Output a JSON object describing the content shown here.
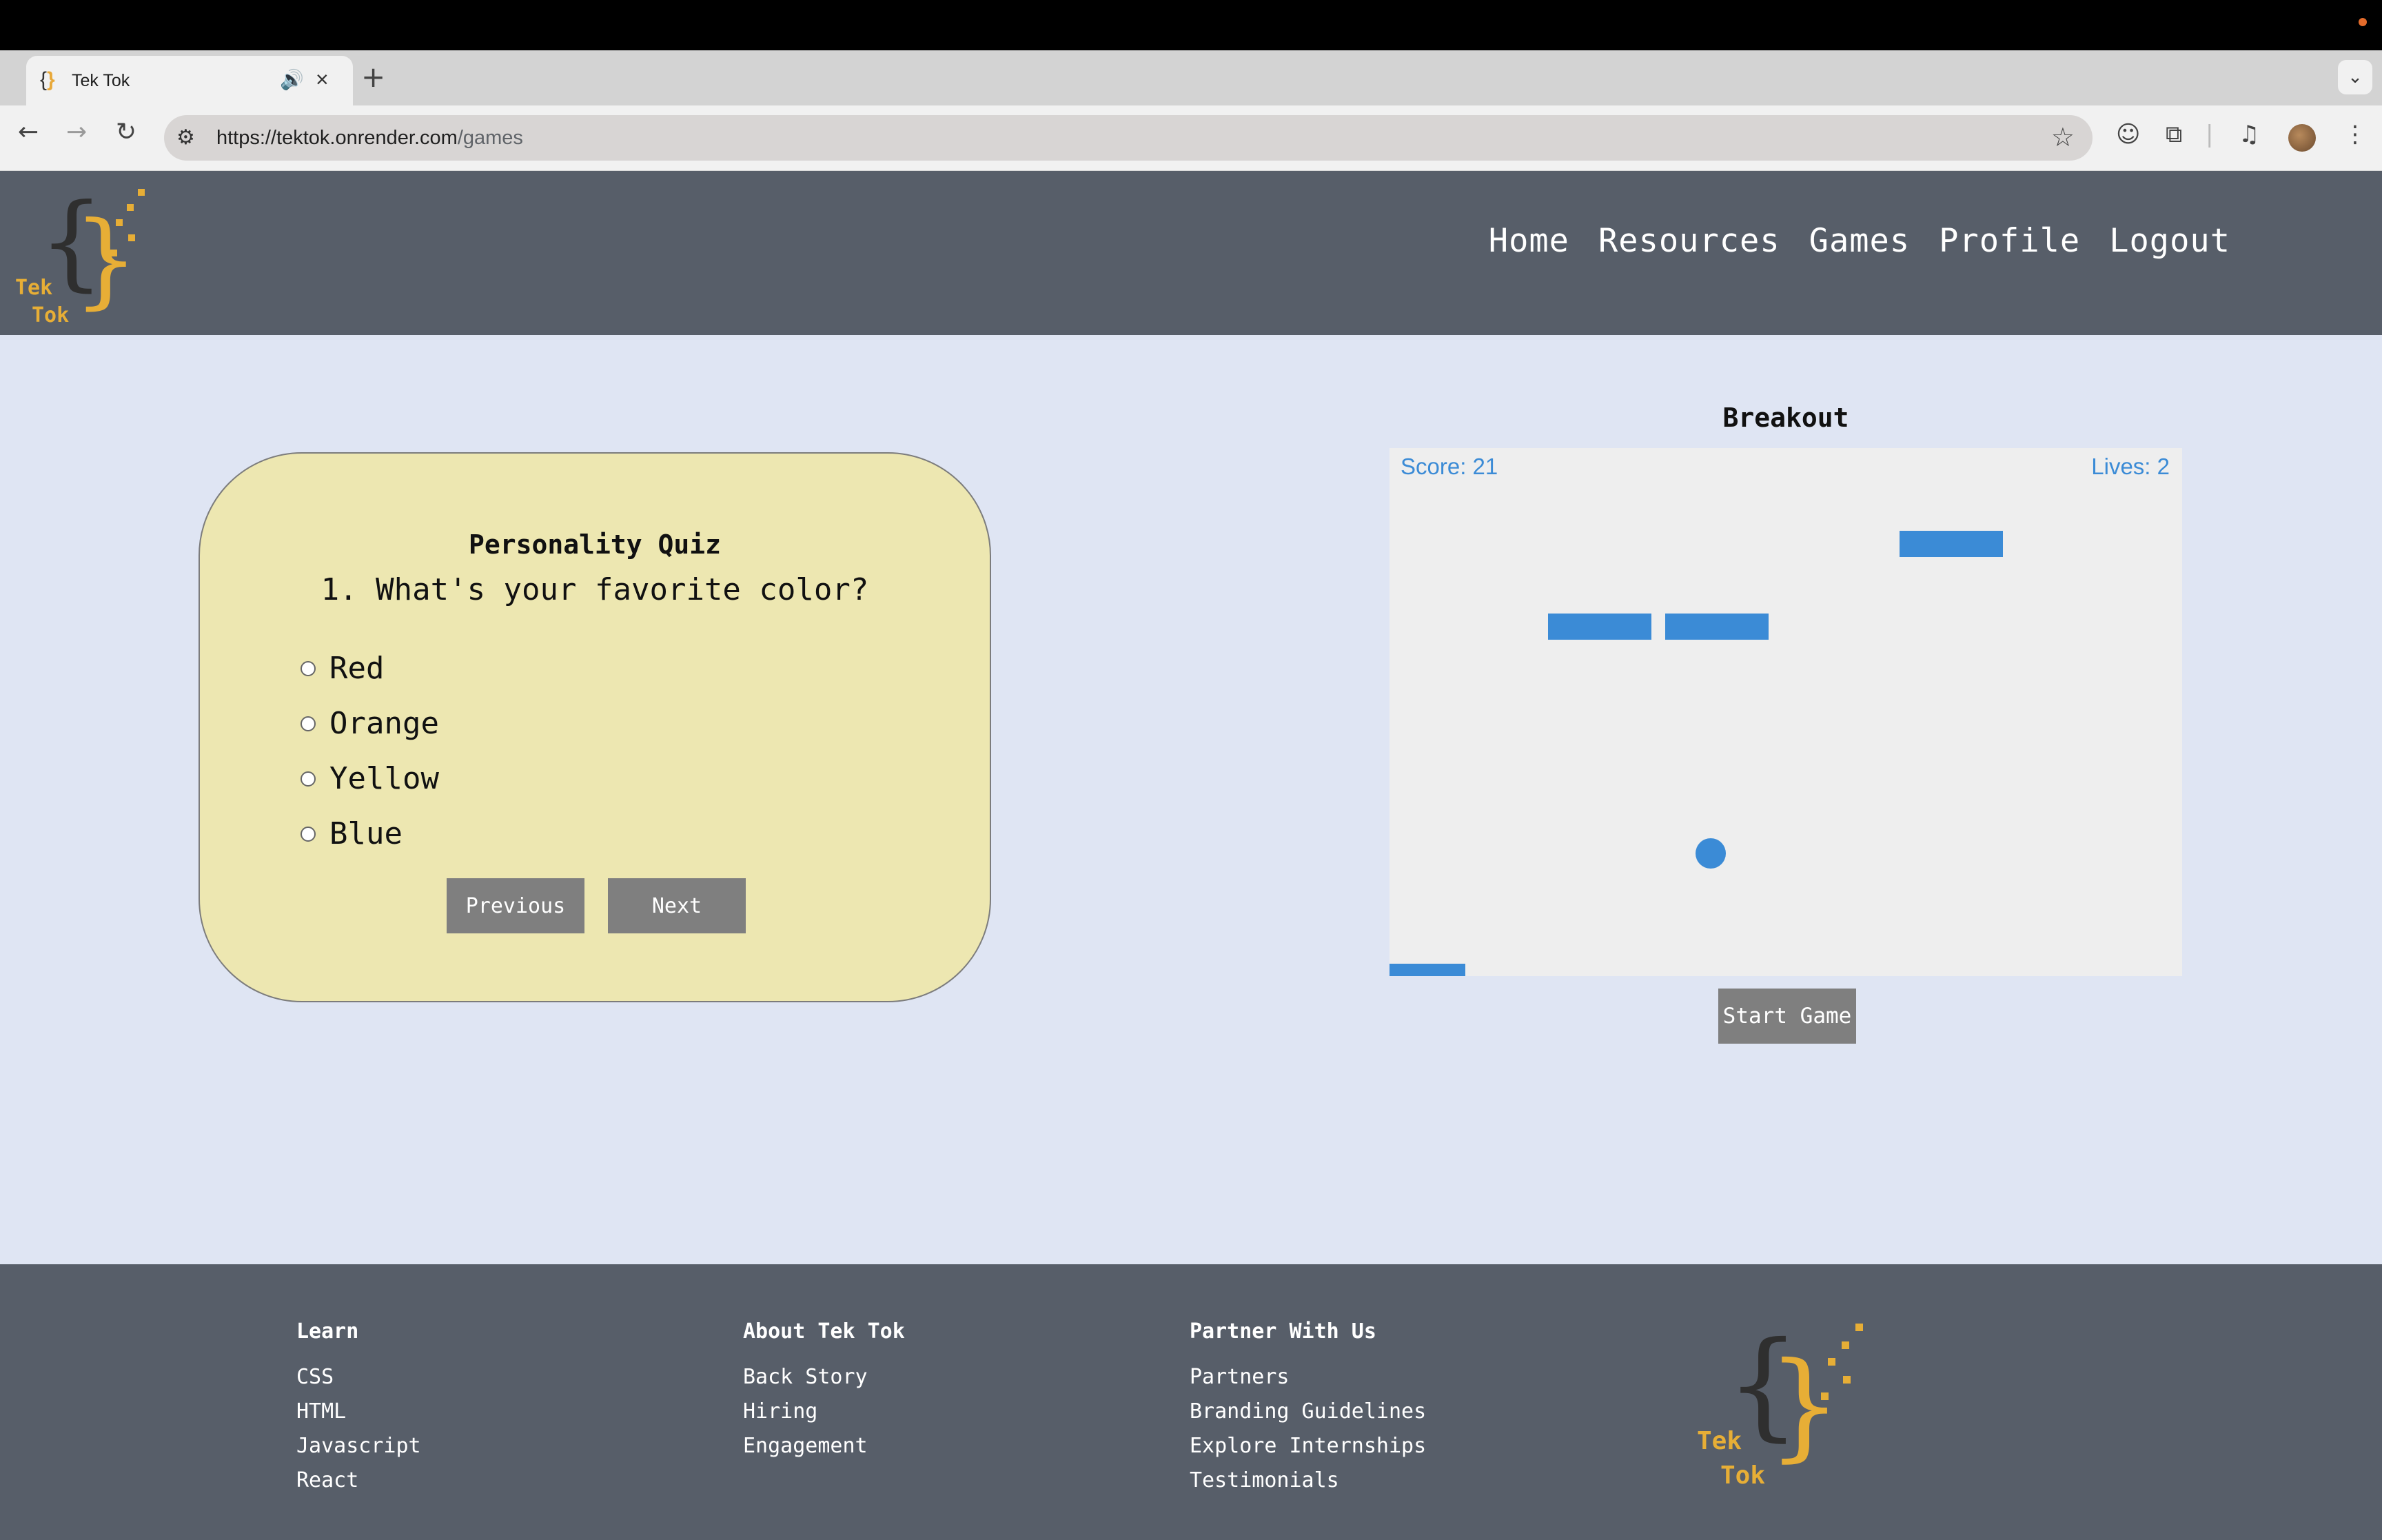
{
  "browser": {
    "tab_title": "Tek Tok",
    "new_tab": "+",
    "url_host": "https://tektok.onrender.com",
    "url_path": "/games"
  },
  "site": {
    "logo_text": [
      "Tek",
      "Tok"
    ],
    "nav": [
      "Home",
      "Resources",
      "Games",
      "Profile",
      "Logout"
    ]
  },
  "quiz": {
    "title": "Personality Quiz",
    "question": "1. What's your favorite color?",
    "options": [
      "Red",
      "Orange",
      "Yellow",
      "Blue"
    ],
    "previous_label": "Previous",
    "next_label": "Next"
  },
  "game": {
    "title": "Breakout",
    "score_text": "Score: 21",
    "lives_text": "Lives: 2",
    "start_label": "Start Game",
    "remaining_bricks": 3
  },
  "footer": {
    "columns": [
      {
        "heading": "Learn",
        "links": [
          "CSS",
          "HTML",
          "Javascript",
          "React"
        ]
      },
      {
        "heading": "About Tek Tok",
        "links": [
          "Back Story",
          "Hiring",
          "Engagement"
        ]
      },
      {
        "heading": "Partner With Us",
        "links": [
          "Partners",
          "Branding Guidelines",
          "Explore Internships",
          "Testimonials"
        ]
      }
    ]
  },
  "colors": {
    "header_bg": "#575e69",
    "page_bg": "#dfe5f3",
    "quiz_card": "#ede7b1",
    "game_blue": "#3b8bd6",
    "logo_gold": "#e7ae36"
  }
}
